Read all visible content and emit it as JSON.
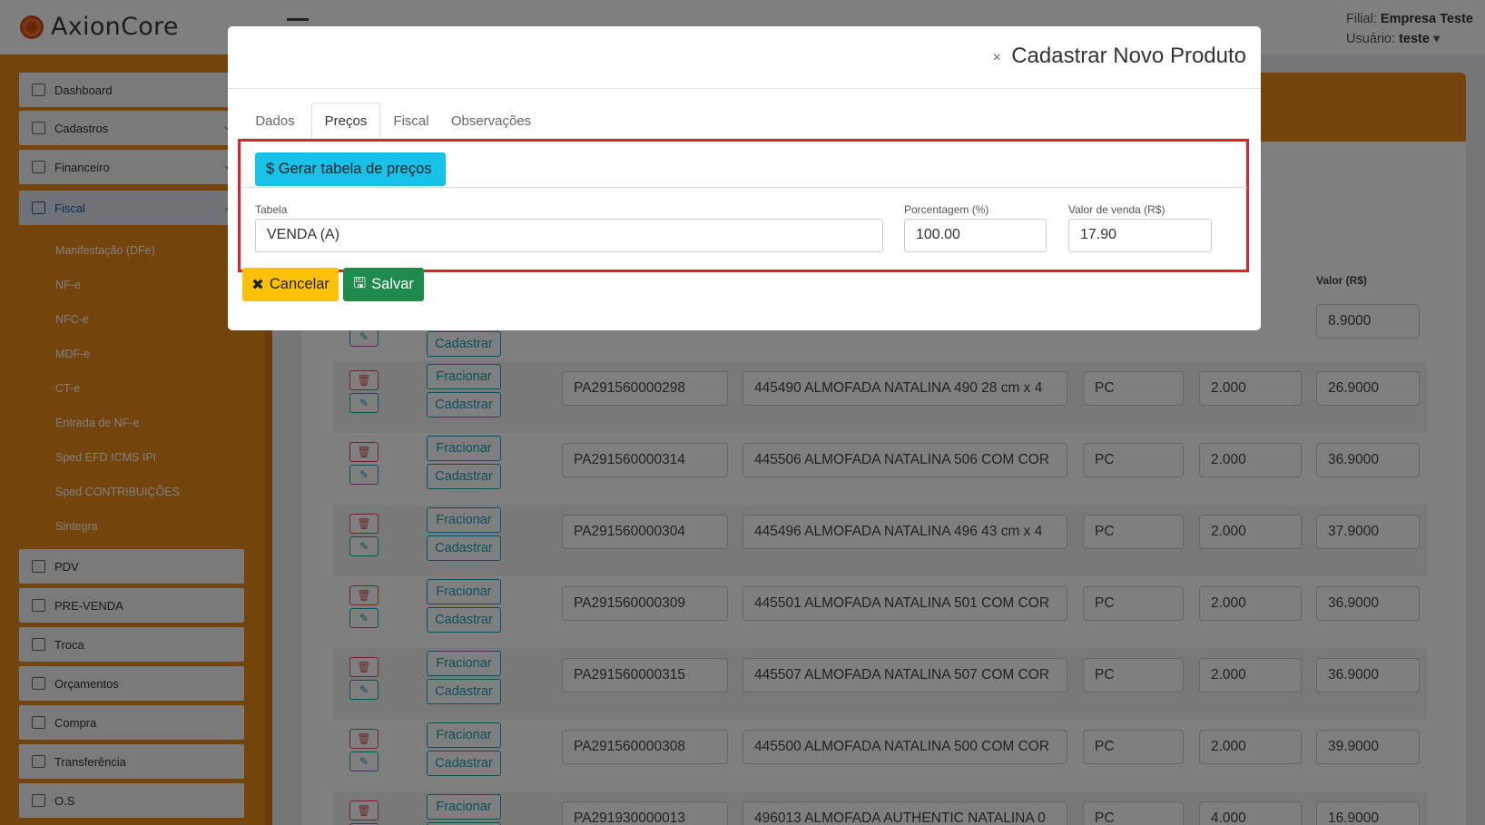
{
  "app": {
    "logo_text": "AxionCore",
    "filial_label": "Filial:",
    "filial_value": "Empresa Teste",
    "usuario_label": "Usuário:",
    "usuario_value": "teste"
  },
  "sidebar": {
    "items": [
      {
        "label": "Dashboard"
      },
      {
        "label": "Cadastros"
      },
      {
        "label": "Financeiro"
      },
      {
        "label": "Fiscal"
      },
      {
        "label": "PDV"
      },
      {
        "label": "PRE-VENDA"
      },
      {
        "label": "Troca"
      },
      {
        "label": "Orçamentos"
      },
      {
        "label": "Compra"
      },
      {
        "label": "Transferência"
      },
      {
        "label": "O.S"
      }
    ],
    "fiscal_sub": [
      "Manifestação (DFe)",
      "NF-e",
      "NFC-e",
      "MDF-e",
      "CT-e",
      "Entrada de NF-e",
      "Sped EFD ICMS IPI",
      "Sped CONTRIBUIÇÕES",
      "Sintegra"
    ]
  },
  "table": {
    "column_valor": "Valor (R$)",
    "fracionar_label": "Fracionar",
    "cadastrar_label": "Cadastrar",
    "first_row_value": "8.9000",
    "rows": [
      {
        "code": "PA291560000298",
        "desc": "445490  ALMOFADA NATALINA 490 28 cm x 4",
        "un": "PC",
        "qtd": "2.000",
        "valor": "26.9000"
      },
      {
        "code": "PA291560000314",
        "desc": "445506  ALMOFADA NATALINA 506 COM COR",
        "un": "PC",
        "qtd": "2.000",
        "valor": "36.9000"
      },
      {
        "code": "PA291560000304",
        "desc": "445496  ALMOFADA NATALINA 496 43 cm x 4",
        "un": "PC",
        "qtd": "2.000",
        "valor": "37.9000"
      },
      {
        "code": "PA291560000309",
        "desc": "445501  ALMOFADA NATALINA 501 COM COR",
        "un": "PC",
        "qtd": "2.000",
        "valor": "36.9000"
      },
      {
        "code": "PA291560000315",
        "desc": "445507  ALMOFADA NATALINA 507 COM COR",
        "un": "PC",
        "qtd": "2.000",
        "valor": "36.9000"
      },
      {
        "code": "PA291560000308",
        "desc": "445500  ALMOFADA NATALINA 500 COM COR",
        "un": "PC",
        "qtd": "2.000",
        "valor": "39.9000"
      },
      {
        "code": "PA291930000013",
        "desc": "496013  ALMOFADA AUTHENTIC NATALINA 0",
        "un": "PC",
        "qtd": "4.000",
        "valor": "16.9000"
      }
    ]
  },
  "modal": {
    "close_symbol": "×",
    "title": "Cadastrar Novo Produto",
    "tabs": [
      "Dados",
      "Preços",
      "Fiscal",
      "Observações"
    ],
    "generate_button": "Gerar tabela de preços",
    "fields": {
      "tabela_label": "Tabela",
      "tabela_value": "VENDA (A)",
      "porcentagem_label": "Porcentagem (%)",
      "porcentagem_value": "100.00",
      "valor_label": "Valor de venda (R$)",
      "valor_value": "17.90"
    },
    "cancel_button": "Cancelar",
    "save_button": "Salvar"
  }
}
